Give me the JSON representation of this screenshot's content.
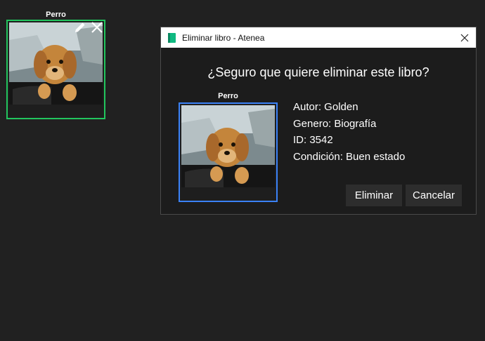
{
  "background_card": {
    "title": "Perro",
    "icons": [
      "pencil-icon",
      "close-icon"
    ],
    "border_color": "#22c55e"
  },
  "dialog": {
    "window_title": "Eliminar libro - Atenea",
    "question": "¿Seguro que quiere eliminar este libro?",
    "card_title": "Perro",
    "card_border_color": "#3b82f6",
    "details": {
      "author": "Autor: Golden",
      "genre": "Genero: Biografía",
      "id": "ID: 3542",
      "condition": "Condición: Buen estado"
    },
    "buttons": {
      "delete": "Eliminar",
      "cancel": "Cancelar"
    }
  }
}
